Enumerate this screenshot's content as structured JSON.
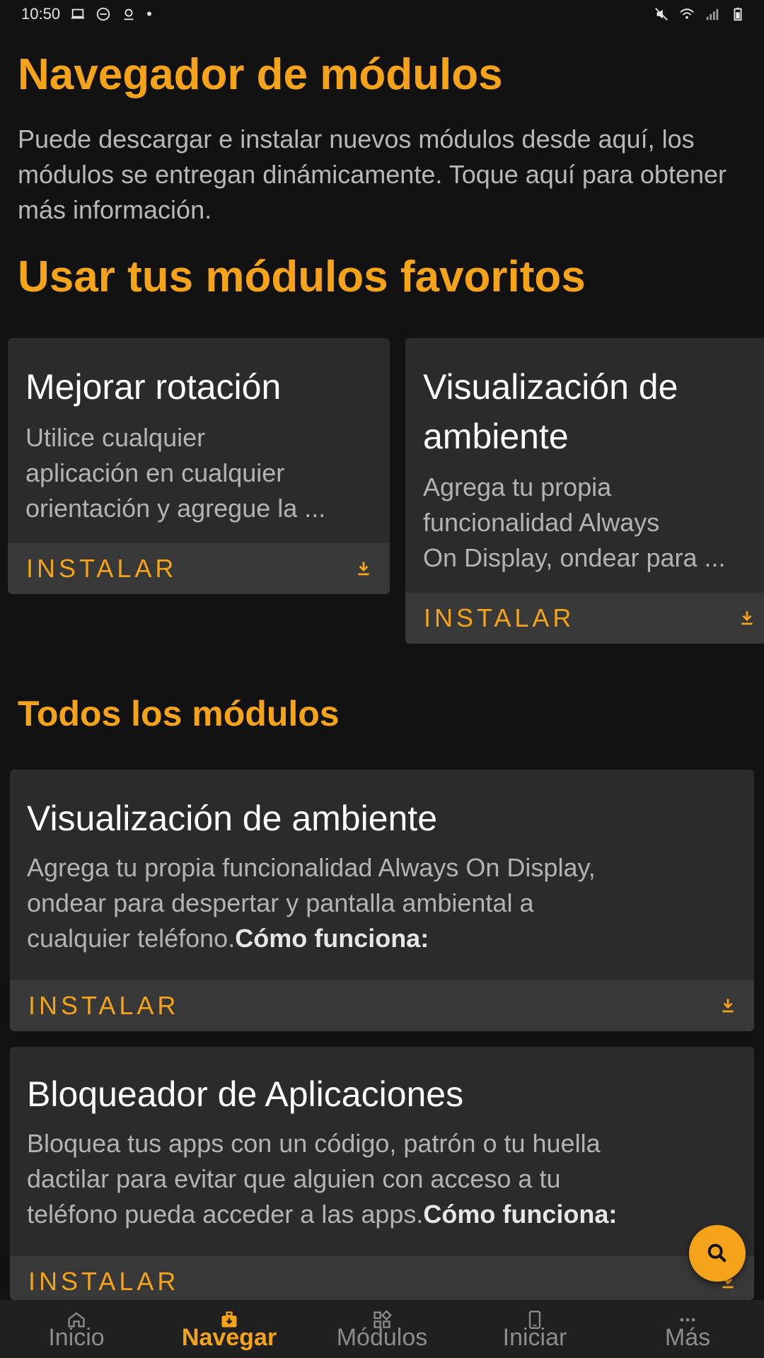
{
  "status_bar": {
    "time": "10:50",
    "dot": "•",
    "left_icons": [
      "laptop-icon",
      "do-not-disturb-icon",
      "location-icon"
    ],
    "right_icons": [
      "mute-icon",
      "wifi-icon",
      "signal-icon",
      "battery-icon"
    ]
  },
  "page": {
    "title": "Navegador de módulos",
    "intro": "Puede descargar e instalar nuevos módulos desde aquí, los módulos se entregan dinámicamente. Toque aquí para obtener más información.",
    "favorites_heading": "Usar tus módulos favoritos",
    "all_heading": "Todos los módulos"
  },
  "favorites": [
    {
      "title": "Mejorar rotación",
      "desc_lines": [
        "Utilice cualquier",
        "aplicación en cualquier",
        "orientación y agregue la ..."
      ],
      "action": "INSTALAR"
    },
    {
      "title_lines": [
        "Visualización de",
        "ambiente"
      ],
      "desc_lines": [
        "Agrega tu propia",
        "funcionalidad Always",
        "On Display, ondear para ..."
      ],
      "action": "INSTALAR"
    }
  ],
  "modules": [
    {
      "title": "Visualización de ambiente",
      "desc_lines": [
        "Agrega tu propia funcionalidad Always On Display,",
        "ondear para despertar y pantalla ambiental a",
        "cualquier teléfono."
      ],
      "desc_bold": "Cómo funciona:",
      "action": "INSTALAR"
    },
    {
      "title": "Bloqueador de Aplicaciones",
      "desc_lines": [
        "Bloquea tus apps con un código, patrón o tu huella",
        "dactilar para evitar que alguien con acceso a tu",
        "teléfono pueda acceder a las apps."
      ],
      "desc_bold": "Cómo funciona:",
      "action": "INSTALAR"
    }
  ],
  "fab": {
    "icon": "search-icon"
  },
  "bottom_nav": [
    {
      "label": "Inicio",
      "icon": "home-icon",
      "active": false
    },
    {
      "label": "Navegar",
      "icon": "briefcase-download-icon",
      "active": true
    },
    {
      "label": "Módulos",
      "icon": "modules-grid-icon",
      "active": false
    },
    {
      "label": "Iniciar",
      "icon": "phone-icon",
      "active": false
    },
    {
      "label": "Más",
      "icon": "more-dots-icon",
      "active": false
    }
  ],
  "colors": {
    "accent": "#f5a319",
    "background": "#121212",
    "card": "#2b2b2b",
    "card_action": "#383838",
    "nav": "#202020"
  }
}
